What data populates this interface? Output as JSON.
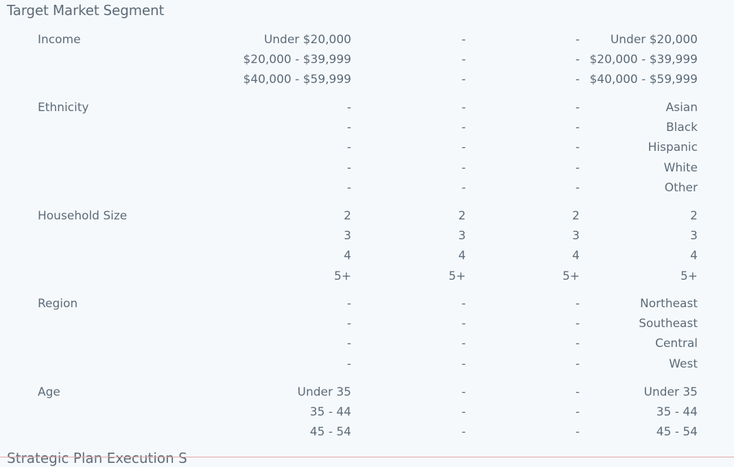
{
  "section_title": "Target Market Segment",
  "next_section_title": "Strategic Plan Execution S",
  "groups": [
    {
      "label": "Income",
      "rows": [
        [
          "Under $20,000",
          "-",
          "-",
          "Under $20,000"
        ],
        [
          "$20,000 - $39,999",
          "-",
          "-",
          "$20,000 - $39,999"
        ],
        [
          "$40,000 - $59,999",
          "-",
          "-",
          "$40,000 - $59,999"
        ]
      ]
    },
    {
      "label": "Ethnicity",
      "rows": [
        [
          "-",
          "-",
          "-",
          "Asian"
        ],
        [
          "-",
          "-",
          "-",
          "Black"
        ],
        [
          "-",
          "-",
          "-",
          "Hispanic"
        ],
        [
          "-",
          "-",
          "-",
          "White"
        ],
        [
          "-",
          "-",
          "-",
          "Other"
        ]
      ]
    },
    {
      "label": "Household Size",
      "rows": [
        [
          "2",
          "2",
          "2",
          "2"
        ],
        [
          "3",
          "3",
          "3",
          "3"
        ],
        [
          "4",
          "4",
          "4",
          "4"
        ],
        [
          "5+",
          "5+",
          "5+",
          "5+"
        ]
      ]
    },
    {
      "label": "Region",
      "rows": [
        [
          "-",
          "-",
          "-",
          "Northeast"
        ],
        [
          "-",
          "-",
          "-",
          "Southeast"
        ],
        [
          "-",
          "-",
          "-",
          "Central"
        ],
        [
          "-",
          "-",
          "-",
          "West"
        ]
      ]
    },
    {
      "label": "Age",
      "rows": [
        [
          "Under 35",
          "-",
          "-",
          "Under 35"
        ],
        [
          "35 - 44",
          "-",
          "-",
          "35 - 44"
        ],
        [
          "45 - 54",
          "-",
          "-",
          "45 - 54"
        ]
      ]
    }
  ]
}
